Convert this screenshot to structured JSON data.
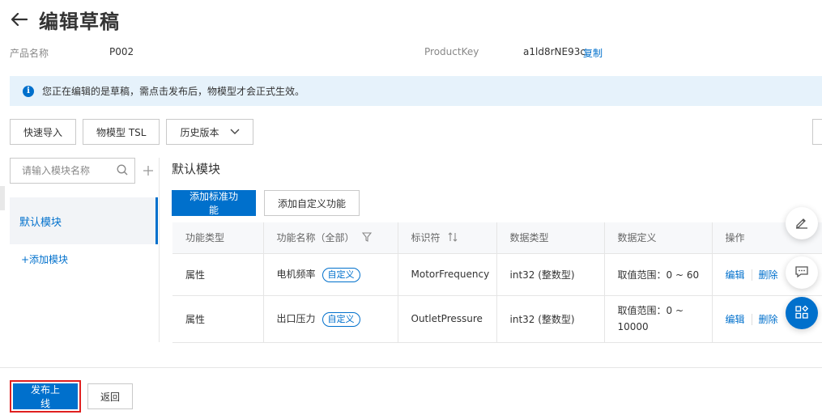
{
  "header": {
    "title": "编辑草稿"
  },
  "meta": {
    "product_name_label": "产品名称",
    "product_name_value": "P002",
    "product_key_label": "ProductKey",
    "product_key_value": "a1ld8rNE93c",
    "copy_label": "复制"
  },
  "info": {
    "message": "您正在编辑的是草稿，需点击发布后，物模型才会正式生效。"
  },
  "toolbar": {
    "quick_import": "快速导入",
    "tsl": "物模型 TSL",
    "history": "历史版本"
  },
  "sidebar": {
    "search_placeholder": "请输入模块名称",
    "modules": [
      {
        "label": "默认模块"
      }
    ],
    "add_module": "+添加模块"
  },
  "content": {
    "section_title": "默认模块",
    "add_standard": "添加标准功能",
    "add_custom": "添加自定义功能"
  },
  "table": {
    "headers": [
      "功能类型",
      "功能名称（全部）",
      "标识符",
      "数据类型",
      "数据定义",
      "操作"
    ],
    "rows": [
      {
        "type": "属性",
        "name": "电机频率",
        "tag": "自定义",
        "identifier": "MotorFrequency",
        "data_type": "int32 (整数型)",
        "definition": "取值范围：0 ~ 60",
        "edit": "编辑",
        "delete": "删除"
      },
      {
        "type": "属性",
        "name": "出口压力",
        "tag": "自定义",
        "identifier": "OutletPressure",
        "data_type": "int32 (整数型)",
        "definition": "取值范围：0 ~ 10000",
        "edit": "编辑",
        "delete": "删除"
      }
    ]
  },
  "footer": {
    "publish": "发布上线",
    "back": "返回"
  },
  "colors": {
    "accent": "#0070cc",
    "info_bg": "#e6f2fb",
    "highlight": "#e02020"
  }
}
